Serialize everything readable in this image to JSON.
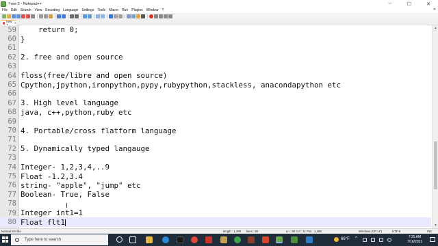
{
  "window": {
    "title": "*new 2 - Notepad++",
    "controls": {
      "minimize": "─",
      "maximize": "☐",
      "close": "✕"
    }
  },
  "menu": {
    "items": [
      "File",
      "Edit",
      "Search",
      "View",
      "Encoding",
      "Language",
      "Settings",
      "Tools",
      "Macro",
      "Run",
      "Plugins",
      "Window",
      "?"
    ],
    "close_glyph": "✕"
  },
  "toolbar": {
    "buttons": [
      "new-file-icon",
      "open-file-icon",
      "save-icon",
      "save-all-icon",
      "close-icon",
      "close-all-icon",
      "print-icon",
      "cut-icon",
      "copy-icon",
      "paste-icon",
      "undo-icon",
      "redo-icon",
      "find-icon",
      "replace-icon",
      "zoom-in-icon",
      "zoom-out-icon",
      "sync-v-icon",
      "sync-h-icon",
      "wrap-icon",
      "show-all-icon",
      "indent-guide-icon",
      "doc-map-icon",
      "function-list-icon",
      "folder-workspace-icon",
      "monitor-icon",
      "record-macro-icon",
      "stop-macro-icon",
      "play-macro-icon",
      "run-macro-icon",
      "save-macro-icon"
    ]
  },
  "tab": {
    "label": "new 2",
    "close_glyph": "✕"
  },
  "editor": {
    "lines": [
      {
        "num": "59",
        "text": "    return 0;"
      },
      {
        "num": "60",
        "text": "}"
      },
      {
        "num": "61",
        "text": ""
      },
      {
        "num": "62",
        "text": "2. free and open source"
      },
      {
        "num": "63",
        "text": ""
      },
      {
        "num": "64",
        "text": "floss(free/libre and open source)"
      },
      {
        "num": "65",
        "text": "Cpython,jpython,ironpython,pypy,rubypython,stackless, anacondapython etc"
      },
      {
        "num": "66",
        "text": ""
      },
      {
        "num": "67",
        "text": "3. High level language"
      },
      {
        "num": "68",
        "text": "java, c++,python,ruby etc"
      },
      {
        "num": "69",
        "text": ""
      },
      {
        "num": "70",
        "text": "4. Portable/cross flatform language"
      },
      {
        "num": "71",
        "text": ""
      },
      {
        "num": "72",
        "text": "5. Dynamically typed langauge"
      },
      {
        "num": "73",
        "text": ""
      },
      {
        "num": "74",
        "text": "Integer- 1,2,3,4,..9"
      },
      {
        "num": "75",
        "text": "Float -1.2,3.4"
      },
      {
        "num": "76",
        "text": "string- \"apple\", \"jump\" etc"
      },
      {
        "num": "77",
        "text": "Boolean- True, False"
      },
      {
        "num": "78",
        "text": ""
      },
      {
        "num": "79",
        "text": "Integer int1=1"
      },
      {
        "num": "80",
        "text": "Float flt1"
      }
    ],
    "current_line": "80"
  },
  "status": {
    "file_type": "Normal text file",
    "length": "length : 1,488",
    "lines": "lines : 80",
    "position": "Ln : 80    Col : 11    Pos : 1,489",
    "eol": "Windows (CR LF)",
    "encoding": "UTF-8",
    "mode": "INS"
  },
  "taskbar": {
    "search_placeholder": "Type here to search",
    "weather": "66°F",
    "chevron": "^",
    "time": "7:25 AM",
    "date": "7/16/2021"
  }
}
